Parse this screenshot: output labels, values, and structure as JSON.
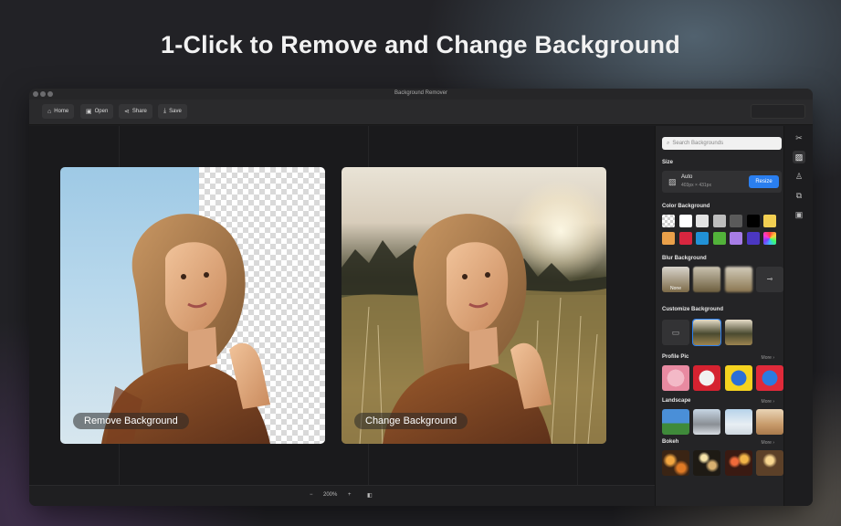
{
  "headline": "1-Click to Remove and Change Background",
  "window": {
    "title": "Background Remover"
  },
  "toolbar": {
    "home": "Home",
    "open": "Open",
    "share": "Share",
    "save": "Save"
  },
  "canvas": {
    "left_caption": "Remove Background",
    "right_caption": "Change Background"
  },
  "statusbar": {
    "minus": "−",
    "zoom": "200%",
    "plus": "+"
  },
  "panel": {
    "search_placeholder": "Search Backgrounds",
    "size": {
      "title": "Size",
      "mode": "Auto",
      "dimensions": "403px × 431px",
      "resize": "Resize"
    },
    "color_background": {
      "title": "Color Background",
      "swatches": [
        "transparent",
        "#ffffff",
        "#e3e3e3",
        "#bdbdbd",
        "#5a5a5a",
        "#000000",
        "#f2cf52",
        "#e9a04a",
        "#d8263f",
        "#2191d6",
        "#52b23a",
        "#a77de6",
        "#4b37c2",
        "rainbow"
      ]
    },
    "blur_background": {
      "title": "Blur Background",
      "none_label": "None"
    },
    "customize_background": {
      "title": "Customize Background"
    },
    "profile_pic": {
      "title": "Profile Pic",
      "more": "More ›"
    },
    "landscape": {
      "title": "Landscape",
      "more": "More ›"
    },
    "bokeh": {
      "title": "Bokeh",
      "more": "More ›"
    }
  },
  "icons": {
    "rail": [
      "scissors-icon",
      "background-icon",
      "person-icon",
      "layers-icon",
      "image-edit-icon"
    ]
  }
}
